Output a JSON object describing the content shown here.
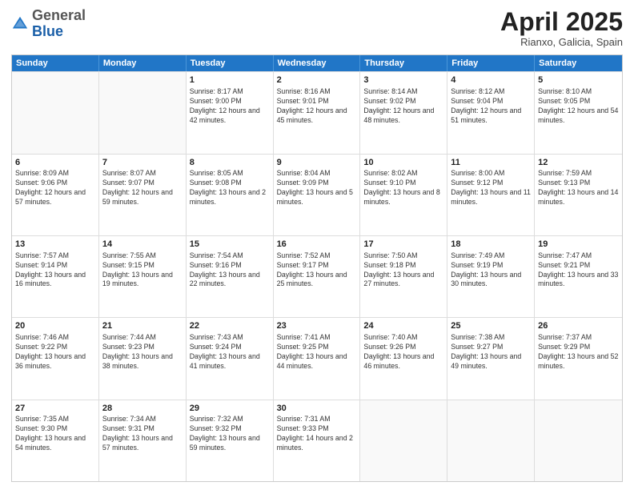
{
  "header": {
    "logo_general": "General",
    "logo_blue": "Blue",
    "month_title": "April 2025",
    "subtitle": "Rianxo, Galicia, Spain"
  },
  "days_of_week": [
    "Sunday",
    "Monday",
    "Tuesday",
    "Wednesday",
    "Thursday",
    "Friday",
    "Saturday"
  ],
  "weeks": [
    [
      {
        "day": "",
        "text": ""
      },
      {
        "day": "",
        "text": ""
      },
      {
        "day": "1",
        "text": "Sunrise: 8:17 AM\nSunset: 9:00 PM\nDaylight: 12 hours and 42 minutes."
      },
      {
        "day": "2",
        "text": "Sunrise: 8:16 AM\nSunset: 9:01 PM\nDaylight: 12 hours and 45 minutes."
      },
      {
        "day": "3",
        "text": "Sunrise: 8:14 AM\nSunset: 9:02 PM\nDaylight: 12 hours and 48 minutes."
      },
      {
        "day": "4",
        "text": "Sunrise: 8:12 AM\nSunset: 9:04 PM\nDaylight: 12 hours and 51 minutes."
      },
      {
        "day": "5",
        "text": "Sunrise: 8:10 AM\nSunset: 9:05 PM\nDaylight: 12 hours and 54 minutes."
      }
    ],
    [
      {
        "day": "6",
        "text": "Sunrise: 8:09 AM\nSunset: 9:06 PM\nDaylight: 12 hours and 57 minutes."
      },
      {
        "day": "7",
        "text": "Sunrise: 8:07 AM\nSunset: 9:07 PM\nDaylight: 12 hours and 59 minutes."
      },
      {
        "day": "8",
        "text": "Sunrise: 8:05 AM\nSunset: 9:08 PM\nDaylight: 13 hours and 2 minutes."
      },
      {
        "day": "9",
        "text": "Sunrise: 8:04 AM\nSunset: 9:09 PM\nDaylight: 13 hours and 5 minutes."
      },
      {
        "day": "10",
        "text": "Sunrise: 8:02 AM\nSunset: 9:10 PM\nDaylight: 13 hours and 8 minutes."
      },
      {
        "day": "11",
        "text": "Sunrise: 8:00 AM\nSunset: 9:12 PM\nDaylight: 13 hours and 11 minutes."
      },
      {
        "day": "12",
        "text": "Sunrise: 7:59 AM\nSunset: 9:13 PM\nDaylight: 13 hours and 14 minutes."
      }
    ],
    [
      {
        "day": "13",
        "text": "Sunrise: 7:57 AM\nSunset: 9:14 PM\nDaylight: 13 hours and 16 minutes."
      },
      {
        "day": "14",
        "text": "Sunrise: 7:55 AM\nSunset: 9:15 PM\nDaylight: 13 hours and 19 minutes."
      },
      {
        "day": "15",
        "text": "Sunrise: 7:54 AM\nSunset: 9:16 PM\nDaylight: 13 hours and 22 minutes."
      },
      {
        "day": "16",
        "text": "Sunrise: 7:52 AM\nSunset: 9:17 PM\nDaylight: 13 hours and 25 minutes."
      },
      {
        "day": "17",
        "text": "Sunrise: 7:50 AM\nSunset: 9:18 PM\nDaylight: 13 hours and 27 minutes."
      },
      {
        "day": "18",
        "text": "Sunrise: 7:49 AM\nSunset: 9:19 PM\nDaylight: 13 hours and 30 minutes."
      },
      {
        "day": "19",
        "text": "Sunrise: 7:47 AM\nSunset: 9:21 PM\nDaylight: 13 hours and 33 minutes."
      }
    ],
    [
      {
        "day": "20",
        "text": "Sunrise: 7:46 AM\nSunset: 9:22 PM\nDaylight: 13 hours and 36 minutes."
      },
      {
        "day": "21",
        "text": "Sunrise: 7:44 AM\nSunset: 9:23 PM\nDaylight: 13 hours and 38 minutes."
      },
      {
        "day": "22",
        "text": "Sunrise: 7:43 AM\nSunset: 9:24 PM\nDaylight: 13 hours and 41 minutes."
      },
      {
        "day": "23",
        "text": "Sunrise: 7:41 AM\nSunset: 9:25 PM\nDaylight: 13 hours and 44 minutes."
      },
      {
        "day": "24",
        "text": "Sunrise: 7:40 AM\nSunset: 9:26 PM\nDaylight: 13 hours and 46 minutes."
      },
      {
        "day": "25",
        "text": "Sunrise: 7:38 AM\nSunset: 9:27 PM\nDaylight: 13 hours and 49 minutes."
      },
      {
        "day": "26",
        "text": "Sunrise: 7:37 AM\nSunset: 9:29 PM\nDaylight: 13 hours and 52 minutes."
      }
    ],
    [
      {
        "day": "27",
        "text": "Sunrise: 7:35 AM\nSunset: 9:30 PM\nDaylight: 13 hours and 54 minutes."
      },
      {
        "day": "28",
        "text": "Sunrise: 7:34 AM\nSunset: 9:31 PM\nDaylight: 13 hours and 57 minutes."
      },
      {
        "day": "29",
        "text": "Sunrise: 7:32 AM\nSunset: 9:32 PM\nDaylight: 13 hours and 59 minutes."
      },
      {
        "day": "30",
        "text": "Sunrise: 7:31 AM\nSunset: 9:33 PM\nDaylight: 14 hours and 2 minutes."
      },
      {
        "day": "",
        "text": ""
      },
      {
        "day": "",
        "text": ""
      },
      {
        "day": "",
        "text": ""
      }
    ]
  ]
}
